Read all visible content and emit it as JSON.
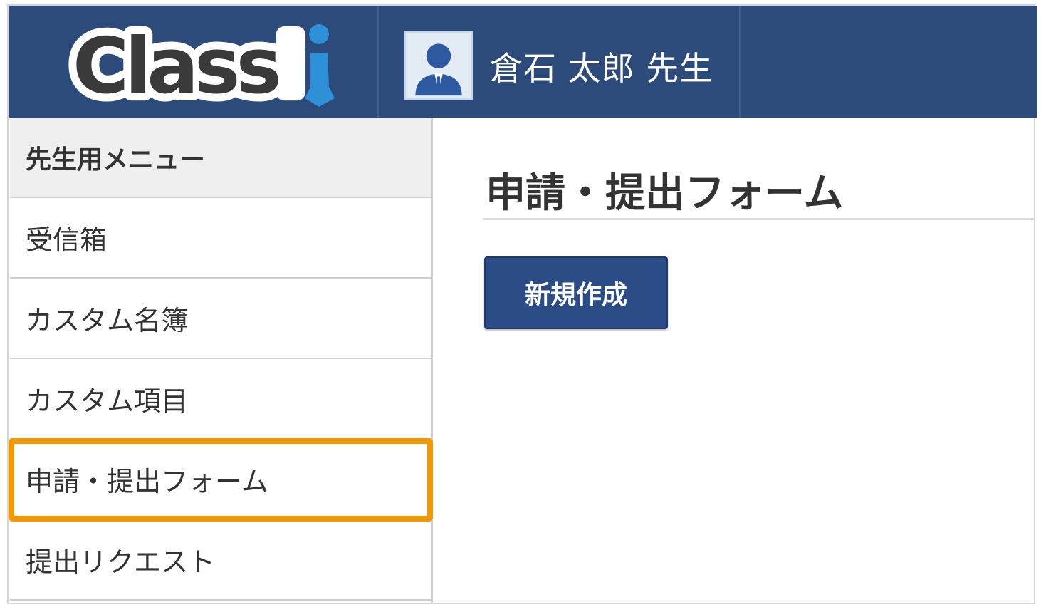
{
  "header": {
    "logo_text": "Classi",
    "user_name": "倉石 太郎 先生",
    "background_color": "#2c4a7a"
  },
  "sidebar": {
    "title": "先生用メニュー",
    "items": [
      {
        "label": "受信箱"
      },
      {
        "label": "カスタム名簿"
      },
      {
        "label": "カスタム項目"
      },
      {
        "label": "申請・提出フォーム",
        "highlighted": true
      },
      {
        "label": "提出リクエスト"
      }
    ],
    "highlight_color": "#f39800"
  },
  "main": {
    "title": "申請・提出フォーム",
    "new_button_label": "新規作成",
    "button_color": "#2b4c86"
  }
}
